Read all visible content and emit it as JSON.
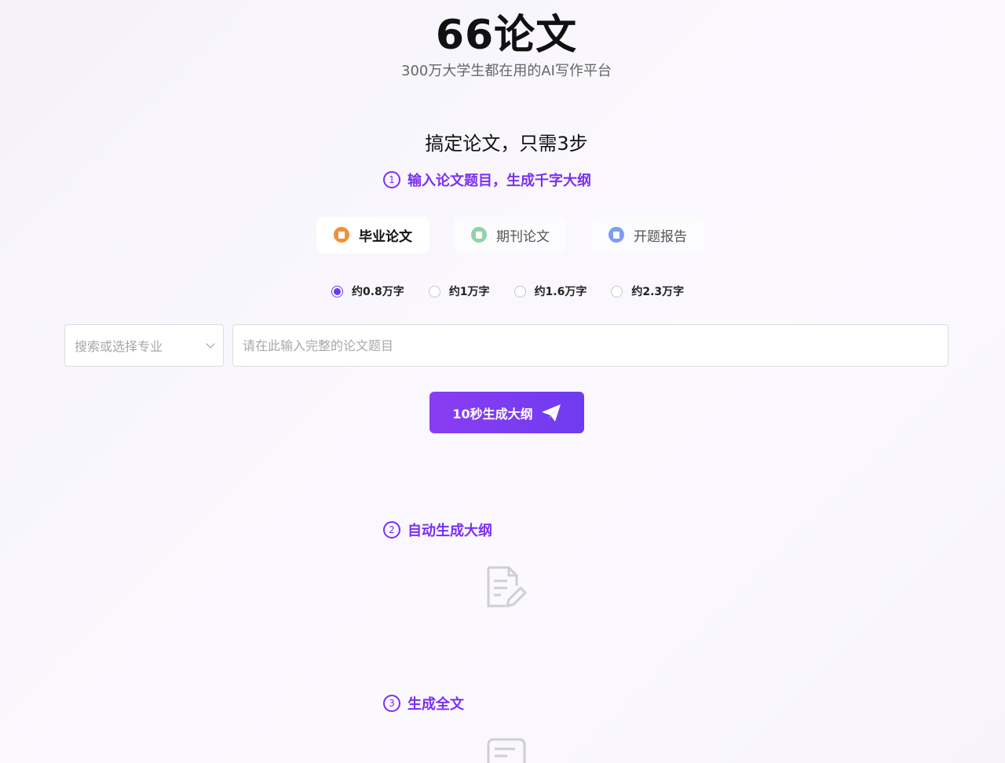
{
  "brand": {
    "title": "66论文",
    "subtitle": "300万大学生都在用的AI写作平台"
  },
  "steps_heading": "搞定论文，只需3步",
  "steps": [
    {
      "number": "1",
      "label": "输入论文题目，生成千字大纲"
    },
    {
      "number": "2",
      "label": "自动生成大纲"
    },
    {
      "number": "3",
      "label": "生成全文"
    }
  ],
  "tabs": [
    {
      "label": "毕业论文",
      "icon": "orange-doc-icon",
      "color": "#f0903a",
      "active": true
    },
    {
      "label": "期刊论文",
      "icon": "green-doc-icon",
      "color": "#8fd3a6",
      "active": false
    },
    {
      "label": "开题报告",
      "icon": "blue-doc-icon",
      "color": "#7e9df0",
      "active": false
    }
  ],
  "word_counts": [
    {
      "label": "约0.8万字",
      "checked": true
    },
    {
      "label": "约1万字",
      "checked": false
    },
    {
      "label": "约1.6万字",
      "checked": false
    },
    {
      "label": "约2.3万字",
      "checked": false
    }
  ],
  "form": {
    "major_placeholder": "搜索或选择专业",
    "topic_placeholder": "请在此输入完整的论文题目",
    "topic_value": ""
  },
  "generate_button": {
    "label": "10秒生成大纲",
    "icon": "paper-plane-icon"
  },
  "colors": {
    "accent": "#7b2ff2",
    "button_start": "#8a3cf3",
    "button_end": "#6f3bf0"
  }
}
